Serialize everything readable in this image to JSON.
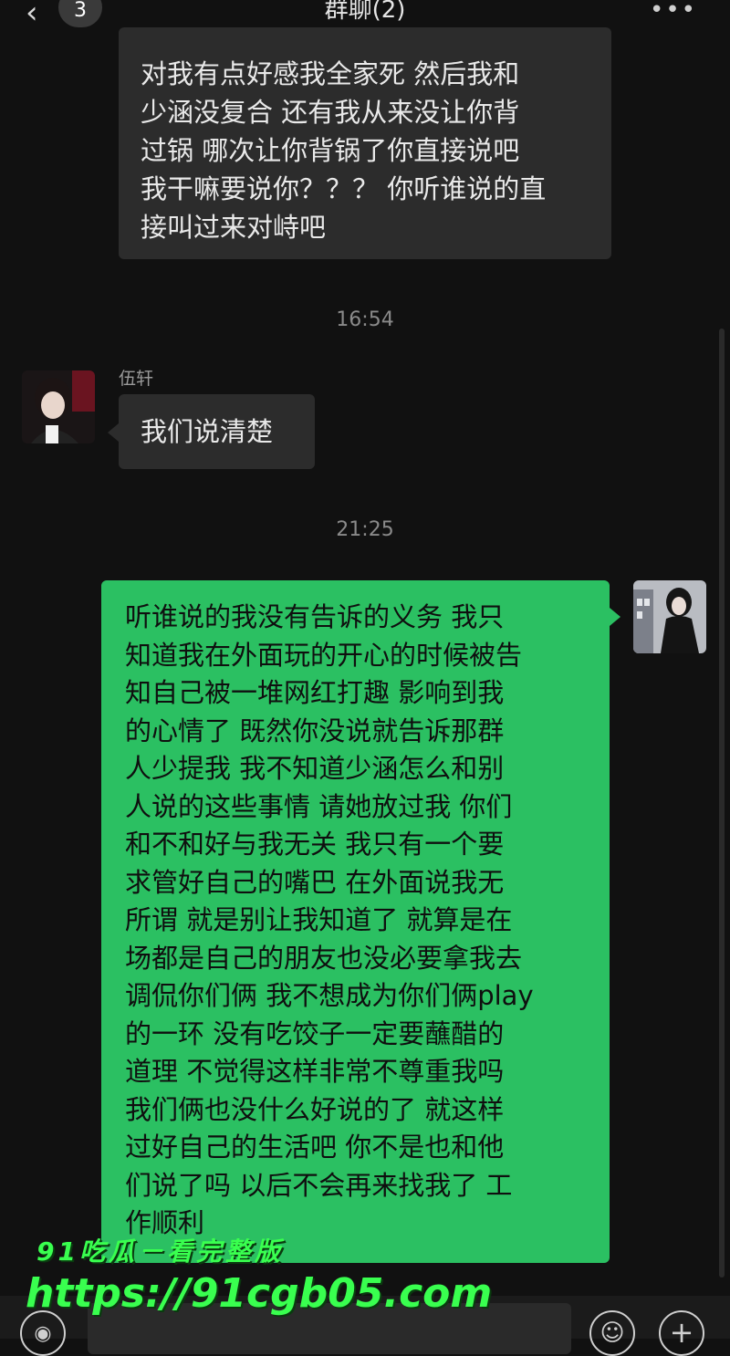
{
  "header": {
    "back_glyph": "‹",
    "unread_count": "3",
    "title": "群聊(2)",
    "more_glyph": "•••"
  },
  "messages": {
    "m1": {
      "lines": [
        "对我有点好感我全家死 然后我和",
        "少涵没复合 还有我从来没让你背",
        "过锅 哪次让你背锅了你直接说吧",
        "我干嘛要说你？？？ 你听谁说的直",
        "接叫过来对峙吧"
      ]
    },
    "time1": "16:54",
    "m2": {
      "sender": "伍轩",
      "text": "我们说清楚"
    },
    "time2": "21:25",
    "m3": {
      "lines": [
        "听谁说的我没有告诉的义务 我只",
        "知道我在外面玩的开心的时候被告",
        "知自己被一堆网红打趣 影响到我",
        "的心情了 既然你没说就告诉那群",
        "人少提我 我不知道少涵怎么和别",
        "人说的这些事情 请她放过我 你们",
        "和不和好与我无关 我只有一个要",
        "求管好自己的嘴巴 在外面说我无",
        "所谓 就是别让我知道了 就算是在",
        "场都是自己的朋友也没必要拿我去",
        "调侃你们俩 我不想成为你们俩play",
        "的一环 没有吃饺子一定要蘸醋的",
        "道理 不觉得这样非常不尊重我吗",
        "我们俩也没什么好说的了 就这样",
        "过好自己的生活吧 你不是也和他",
        "们说了吗 以后不会再来找我了 工",
        "作顺利"
      ]
    }
  },
  "watermark": {
    "line1": "91吃瓜－看完整版",
    "line2": "https://91cgb05.com"
  },
  "colors": {
    "background": "#111111",
    "incoming_bubble": "#2c2c2c",
    "outgoing_bubble": "#2bc062",
    "watermark": "#39ff4f"
  },
  "icons": {
    "voice": "voice-icon",
    "emoji": "emoji-icon",
    "plus": "plus-icon"
  }
}
